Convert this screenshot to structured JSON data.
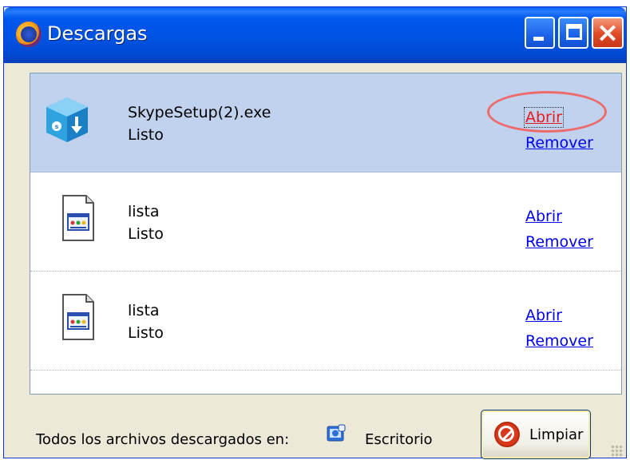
{
  "window": {
    "title": "Descargas"
  },
  "downloads": [
    {
      "name": "SkypeSetup(2).exe",
      "status": "Listo",
      "open_label": "Abrir",
      "remove_label": "Remover",
      "icon": "skype-installer-icon",
      "selected": true
    },
    {
      "name": "lista",
      "status": "Listo",
      "open_label": "Abrir",
      "remove_label": "Remover",
      "icon": "html-document-icon",
      "selected": false
    },
    {
      "name": "lista",
      "status": "Listo",
      "open_label": "Abrir",
      "remove_label": "Remover",
      "icon": "html-document-icon",
      "selected": false
    }
  ],
  "footer": {
    "label": "Todos los archivos descargados en:",
    "folder": "Escritorio",
    "folder_icon": "desktop-folder-icon",
    "clear_label": "Limpiar",
    "clear_icon": "clear-icon"
  },
  "colors": {
    "titlebar": "#0052e0",
    "selected_row": "#c1d2ee",
    "link": "#0000ee",
    "highlight_circle": "#ef6b6b"
  }
}
